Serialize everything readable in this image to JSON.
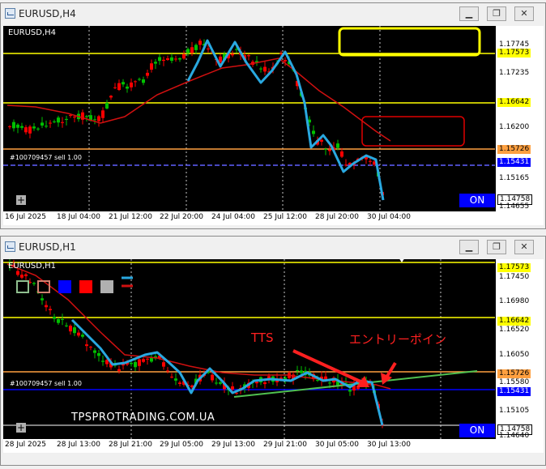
{
  "top_window": {
    "title": "EURUSD,H4",
    "chart_label": "EURUSD,H4",
    "order_label": "#100709457 sell 1.00",
    "on_label": "ON",
    "price_ticks": [
      "1.17745",
      "1.17235",
      "1.16620",
      "1.16200",
      "1.15165",
      "1.14655"
    ],
    "price_tags": {
      "yellow": "1.17573",
      "yellow2": "1.16642",
      "orange": "1.15726",
      "blue": "1.15431",
      "current": "1.14758"
    },
    "time_labels": [
      "16 Jul 2025",
      "18 Jul 04:00",
      "21 Jul 12:00",
      "22 Jul 20:00",
      "24 Jul 04:00",
      "25 Jul 12:00",
      "28 Jul 20:00",
      "30 Jul 04:00"
    ]
  },
  "bottom_window": {
    "title": "EURUSD,H1",
    "chart_label": "EURUSD,H1",
    "order_label": "#100709457 sell 1.00",
    "on_label": "ON",
    "watermark": "TPSPROTRADING.COM.UA",
    "annotation_tts": "TTS",
    "annotation_entry": "エントリーポイン",
    "price_ticks": [
      "1.17450",
      "1.16980",
      "1.16520",
      "1.16050",
      "1.15580",
      "1.15105",
      "1.14640"
    ],
    "price_tags": {
      "yellow": "1.17573",
      "yellow2": "1.16642",
      "orange": "1.15726",
      "blue": "1.15431",
      "current": "1.14758"
    },
    "time_labels": [
      "28 Jul 2025",
      "28 Jul 13:00",
      "28 Jul 21:00",
      "29 Jul 05:00",
      "29 Jul 13:00",
      "29 Jul 21:00",
      "30 Jul 05:00",
      "30 Jul 13:00"
    ]
  },
  "buttons": {
    "minimize": "▁",
    "restore": "❐",
    "close": "✕"
  },
  "colors": {
    "yellow": "#ffff00",
    "orange": "#ffa040",
    "blue": "#0000ff",
    "cyan": "#29a8e0",
    "red_ma": "#d01010",
    "green": "#00c000",
    "bear": "#ff0000"
  }
}
